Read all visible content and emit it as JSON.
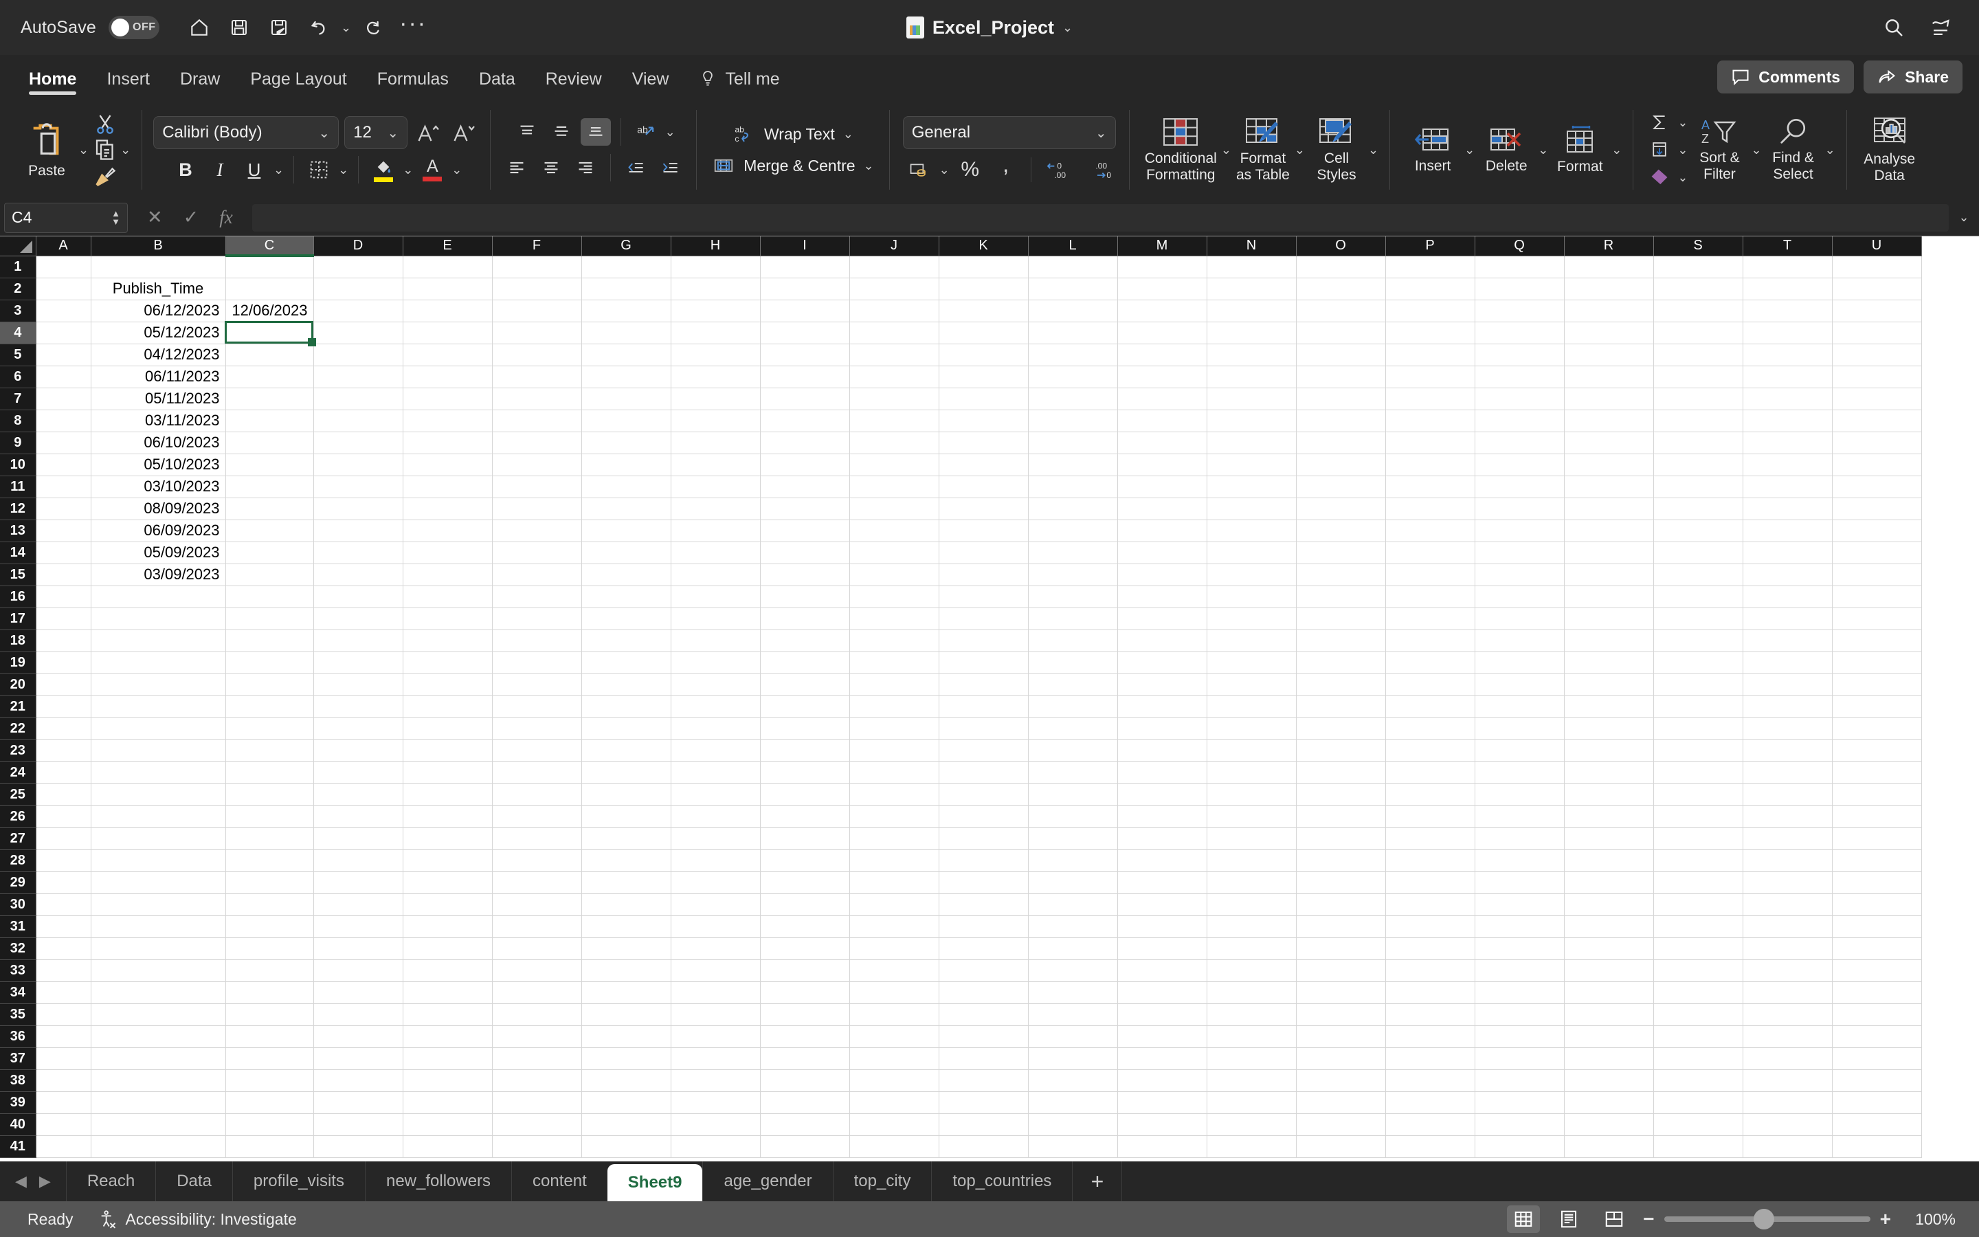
{
  "titlebar": {
    "autosave_label": "AutoSave",
    "autosave_state": "OFF",
    "doc_title": "Excel_Project",
    "quick_access": [
      {
        "name": "home-icon",
        "label": "Home"
      },
      {
        "name": "save-icon",
        "label": "Save"
      },
      {
        "name": "save-as-icon",
        "label": "Save As"
      },
      {
        "name": "undo-icon",
        "label": "Undo"
      },
      {
        "name": "redo-icon",
        "label": "Redo"
      },
      {
        "name": "more-options-icon",
        "label": "More"
      }
    ],
    "search_label": "Search",
    "ribbon_display_label": "Ribbon Display Options"
  },
  "ribbon_tabs": {
    "tabs": [
      {
        "label": "Home",
        "active": true
      },
      {
        "label": "Insert",
        "active": false
      },
      {
        "label": "Draw",
        "active": false
      },
      {
        "label": "Page Layout",
        "active": false
      },
      {
        "label": "Formulas",
        "active": false
      },
      {
        "label": "Data",
        "active": false
      },
      {
        "label": "Review",
        "active": false
      },
      {
        "label": "View",
        "active": false
      },
      {
        "label": "Tell me",
        "active": false
      }
    ],
    "comments_label": "Comments",
    "share_label": "Share"
  },
  "ribbon": {
    "clipboard": {
      "paste_label": "Paste",
      "cut_label": "Cut",
      "copy_label": "Copy",
      "format_painter_label": "Format Painter"
    },
    "font": {
      "font_name": "Calibri (Body)",
      "font_size": "12",
      "grow_label": "Increase Font Size",
      "shrink_label": "Decrease Font Size",
      "bold_label": "B",
      "italic_label": "I",
      "underline_label": "U",
      "borders_label": "Borders",
      "fill_color_label": "Fill Colour",
      "font_color_label": "Font Colour",
      "fill_color": "#ffe600",
      "font_color": "#e03131"
    },
    "alignment": {
      "top_align_label": "Top Align",
      "middle_align_label": "Middle Align",
      "bottom_align_label": "Bottom Align",
      "align_left_label": "Align Left",
      "align_center_label": "Centre",
      "align_right_label": "Align Right",
      "orientation_label": "Orientation",
      "decrease_indent_label": "Decrease Indent",
      "increase_indent_label": "Increase Indent",
      "wrap_text_label": "Wrap Text",
      "merge_centre_label": "Merge & Centre"
    },
    "number": {
      "format_value": "General",
      "accounting_label": "Accounting Number Format",
      "percent_label": "Percent Style",
      "comma_label": "Comma Style",
      "increase_decimal_label": "Increase Decimal",
      "decrease_decimal_label": "Decrease Decimal"
    },
    "styles": {
      "conditional_formatting_label": "Conditional\nFormatting",
      "conditional_formatting_line1": "Conditional",
      "conditional_formatting_line2": "Formatting",
      "format_as_table_line1": "Format",
      "format_as_table_line2": "as Table",
      "cell_styles_line1": "Cell",
      "cell_styles_line2": "Styles"
    },
    "cells": {
      "insert_label": "Insert",
      "delete_label": "Delete",
      "format_label": "Format"
    },
    "editing": {
      "autosum_label": "AutoSum",
      "fill_label": "Fill",
      "clear_label": "Clear",
      "sort_filter_line1": "Sort &",
      "sort_filter_line2": "Filter",
      "find_select_line1": "Find &",
      "find_select_line2": "Select"
    },
    "analyse": {
      "line1": "Analyse",
      "line2": "Data"
    }
  },
  "formula_bar": {
    "name_box_value": "C4",
    "cancel_label": "Cancel",
    "enter_label": "Enter",
    "function_label": "Insert Function",
    "formula_value": "",
    "expand_label": "Expand Formula Bar"
  },
  "grid": {
    "columns": [
      "A",
      "B",
      "C",
      "D",
      "E",
      "F",
      "G",
      "H",
      "I",
      "J",
      "K",
      "L",
      "M",
      "N",
      "O",
      "P",
      "Q",
      "R",
      "S",
      "T",
      "U"
    ],
    "selected_column": "C",
    "selected_row": 4,
    "first_row": 1,
    "last_row": 41,
    "cells": {
      "B2": "Publish_Time",
      "B3": "06/12/2023",
      "B4": "05/12/2023",
      "B5": "04/12/2023",
      "B6": "06/11/2023",
      "B7": "05/11/2023",
      "B8": "03/11/2023",
      "B9": "06/10/2023",
      "B10": "05/10/2023",
      "B11": "03/10/2023",
      "B12": "08/09/2023",
      "B13": "06/09/2023",
      "B14": "05/09/2023",
      "B15": "03/09/2023",
      "C3": "12/06/2023"
    }
  },
  "sheet_tabs": {
    "tabs": [
      {
        "label": "Reach",
        "active": false
      },
      {
        "label": "Data",
        "active": false
      },
      {
        "label": "profile_visits",
        "active": false
      },
      {
        "label": "new_followers",
        "active": false
      },
      {
        "label": "content",
        "active": false
      },
      {
        "label": "Sheet9",
        "active": true
      },
      {
        "label": "age_gender",
        "active": false
      },
      {
        "label": "top_city",
        "active": false
      },
      {
        "label": "top_countries",
        "active": false
      }
    ],
    "add_sheet_label": "+",
    "prev_label": "Previous Sheet",
    "next_label": "Next Sheet"
  },
  "status_bar": {
    "status": "Ready",
    "accessibility": "Accessibility: Investigate",
    "view_normal_label": "Normal View",
    "view_layout_label": "Page Layout View",
    "view_break_label": "Page Break Preview",
    "zoom_out_label": "−",
    "zoom_in_label": "+",
    "zoom_value": "100%"
  }
}
